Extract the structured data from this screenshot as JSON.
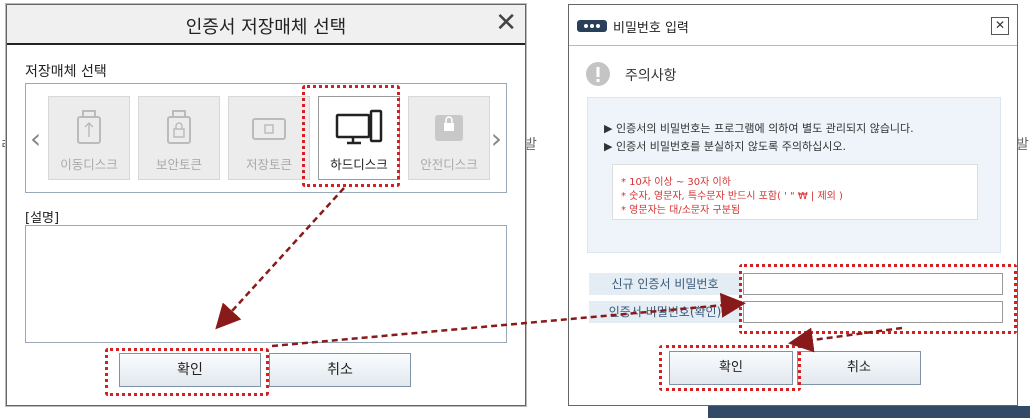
{
  "left_dialog": {
    "title": "인증서 저장매체 선택",
    "close_glyph": "✕",
    "section_label": "저장매체 선택",
    "prev_glyph": "‹",
    "next_glyph": "›",
    "media": [
      {
        "label": "이동디스크",
        "icon": "usb-drive-icon",
        "state": "disabled"
      },
      {
        "label": "보안토큰",
        "icon": "security-token-icon",
        "state": "disabled"
      },
      {
        "label": "저장토큰",
        "icon": "storage-token-icon",
        "state": "disabled"
      },
      {
        "label": "하드디스크",
        "icon": "hard-disk-icon",
        "state": "selected"
      },
      {
        "label": "안전디스크",
        "icon": "secure-disk-icon",
        "state": "disabled"
      }
    ],
    "description_label": "[설명]",
    "ok_label": "확인",
    "cancel_label": "취소"
  },
  "right_dialog": {
    "title": "비밀번호 입력",
    "close_glyph": "✕",
    "notice_title": "주의사항",
    "notice_lines": [
      "▶ 인증서의 비밀번호는 프로그램에 의하여 별도 관리되지 않습니다.",
      "▶ 인증서 비밀번호를 분실하지 않도록 주의하십시오."
    ],
    "rules": [
      "* 10자 이상 ~ 30자 이하",
      "* 숫자, 영문자, 특수문자 반드시 포함( ' \" ₩ | 제외 )",
      "* 영문자는 대/소문자 구분됨"
    ],
    "new_password_label": "신규 인증서 비밀번호",
    "confirm_password_label": "인증서 비밀번호(확인)",
    "ok_label": "확인",
    "cancel_label": "취소"
  },
  "colors": {
    "highlight": "#d42020",
    "button_border": "#7f93a8",
    "label_bg": "#e4ecf4"
  }
}
